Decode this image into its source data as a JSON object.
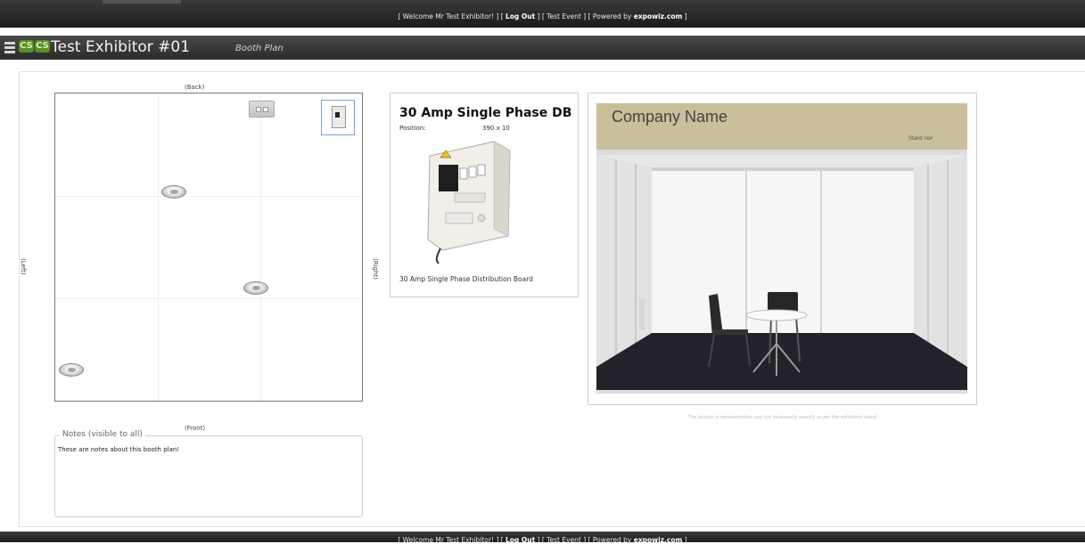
{
  "header": {
    "welcome": "[ Welcome Mr Test Exhibitor! ]",
    "logout_label": "Log Out",
    "event_label": "Test Event",
    "powered_prefix": "Powered by",
    "powered_brand": "expowiz.com"
  },
  "title_bar": {
    "logo_text": "CS",
    "exhibitor_name": "Test Exhibitor #01",
    "page_subtitle": "Booth Plan"
  },
  "booth_plan": {
    "label_back": "(Back)",
    "label_front": "(Front)",
    "label_left": "(Left)",
    "label_right": "(Right)",
    "items": [
      "socket",
      "socket",
      "socket",
      "switch",
      "distribution-board"
    ]
  },
  "notes": {
    "legend": "Notes (visible to all)",
    "value": "These are notes about this booth plan!"
  },
  "item_detail": {
    "title": "30 Amp Single Phase DB",
    "position_label": "Position:",
    "position_value": "390 x 10",
    "description": "30 Amp Single Phase Distribution Board"
  },
  "booth_preview": {
    "company_name": "Company Name",
    "stand_no": "Stand no#",
    "disclaimer": "The picture is representative and not necessarily exactly as per the exhibition stand"
  },
  "colors": {
    "brand_green": "#5a8f2a",
    "header_dark": "#222222",
    "fascia_tan": "#c9bf9a"
  }
}
